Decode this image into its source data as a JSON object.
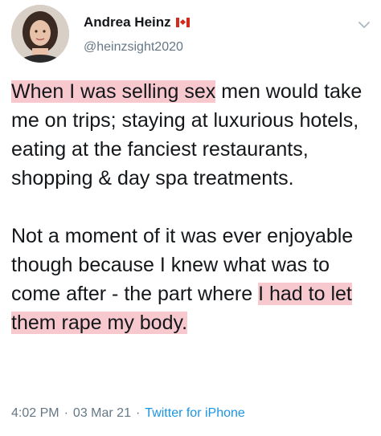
{
  "author": {
    "name": "Andrea Heinz",
    "handle": "@heinzsight2020",
    "flag_icon": "canada-flag-icon",
    "avatar_icon": "profile-photo"
  },
  "tweet": {
    "para1_hl": "When I was selling sex",
    "para1_rest": " men would take me on trips; staying at luxurious hotels, eating at the fanciest restaurants, shopping & day spa treatments.",
    "para2_pre": "Not a moment of it was ever enjoyable though because I knew what was to come after - the part where ",
    "para2_hl": "I had to let them rape my body.",
    "highlight_color": "#f7c9cf"
  },
  "meta": {
    "time": "4:02 PM",
    "sep1": "·",
    "date": "03 Mar 21",
    "sep2": "·",
    "source": "Twitter for iPhone"
  }
}
